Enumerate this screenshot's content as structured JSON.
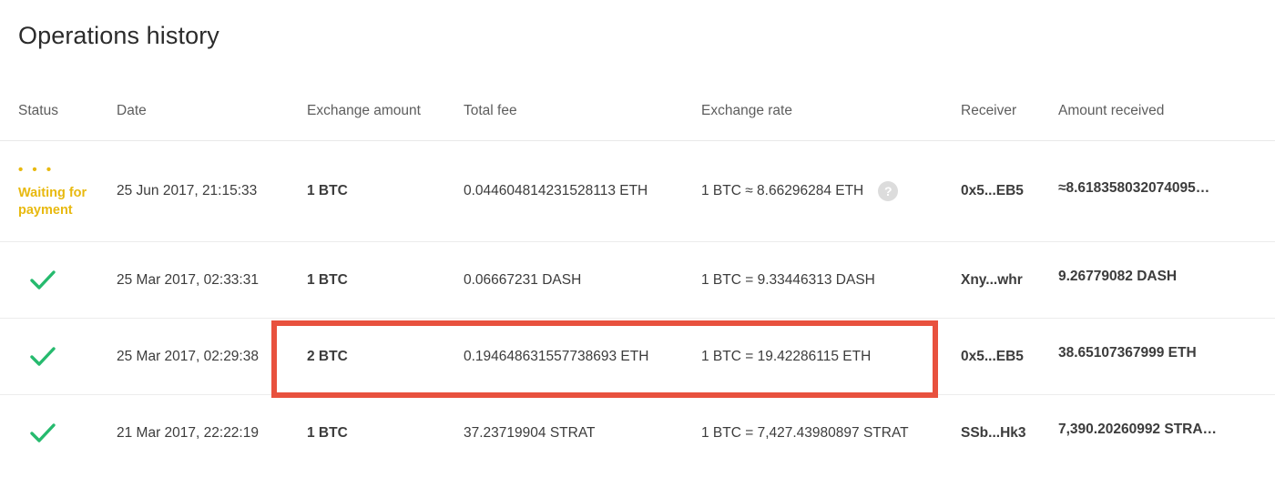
{
  "header": {
    "title": "Operations history"
  },
  "table": {
    "columns": [
      {
        "key": "status",
        "label": "Status"
      },
      {
        "key": "date",
        "label": "Date"
      },
      {
        "key": "amount",
        "label": "Exchange amount"
      },
      {
        "key": "fee",
        "label": "Total fee"
      },
      {
        "key": "rate",
        "label": "Exchange rate"
      },
      {
        "key": "receiver",
        "label": "Receiver"
      },
      {
        "key": "received",
        "label": "Amount received"
      }
    ],
    "rows": [
      {
        "status_type": "pending",
        "status_dots": "• • •",
        "status_label": "Waiting for payment",
        "date": "25 Jun 2017, 21:15:33",
        "amount": "1 BTC",
        "fee": "0.044604814231528113 ETH",
        "rate": "1 BTC ≈ 8.66296284 ETH",
        "has_help_icon": true,
        "help_icon_glyph": "?",
        "receiver": "0x5...EB5",
        "received": "≈8.618358032074095…"
      },
      {
        "status_type": "done",
        "status_label": "",
        "date": "25 Mar 2017, 02:33:31",
        "amount": "1 BTC",
        "fee": "0.06667231 DASH",
        "rate": "1 BTC = 9.33446313 DASH",
        "has_help_icon": false,
        "receiver": "Xny...whr",
        "received": "9.26779082 DASH"
      },
      {
        "status_type": "done",
        "status_label": "",
        "date": "25 Mar 2017, 02:29:38",
        "amount": "2 BTC",
        "fee": "0.194648631557738693 ETH",
        "rate": "1 BTC = 19.42286115 ETH",
        "has_help_icon": false,
        "receiver": "0x5...EB5",
        "received": "38.65107367999 ETH"
      },
      {
        "status_type": "done",
        "status_label": "",
        "date": "21 Mar 2017, 22:22:19",
        "amount": "1 BTC",
        "fee": "37.23719904 STRAT",
        "rate": "1 BTC = 7,427.43980897 STRAT",
        "has_help_icon": false,
        "receiver": "SSb...Hk3",
        "received": "7,390.20260992 STRA…"
      }
    ]
  },
  "annotation": {
    "highlight_color": "#e8513e"
  },
  "colors": {
    "pending": "#e8b90f",
    "success": "#26ba6e",
    "help_icon_bg": "#dcdcdc",
    "text": "#3c3c3c",
    "header_text": "#5d5d5d"
  }
}
